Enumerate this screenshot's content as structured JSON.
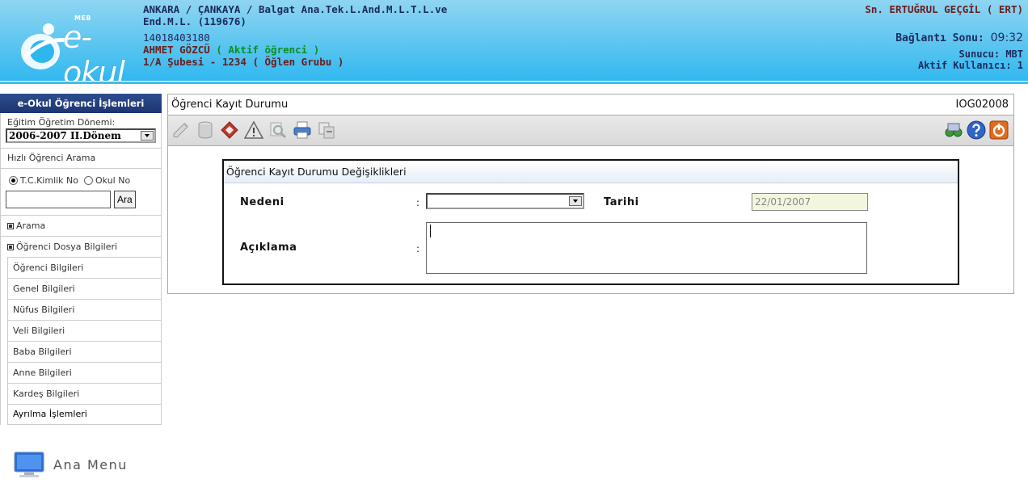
{
  "header": {
    "logo_text": "e-okul",
    "logo_meb": "MEB",
    "school_line1": "ANKARA / ÇANKAYA / Balgat Ana.Tek.L.And.M.L.T.L.ve",
    "school_line2": "End.M.L. (119676)",
    "student_id": "14018403180",
    "student_name": "AHMET GÖZCÜ",
    "student_status": "( Aktif öğrenci )",
    "student_class": "1/A Şubesi - 1234 ( Öğlen Grubu )",
    "user": "Sn. ERTUĞRUL GEÇGİL ( ERT)",
    "connection_label": "Bağlantı Sonu:",
    "connection_time": "09:32",
    "server": "Sunucu: MBT",
    "active_users": "Aktif Kullanıcı: 1"
  },
  "sidebar": {
    "title": "e-Okul Öğrenci İşlemleri",
    "period_label": "Eğitim Öğretim Dönemi:",
    "period_value": "2006-2007 II.Dönem",
    "quick_search_label": "Hızlı Öğrenci Arama",
    "radio_tc": "T.C.Kimlik No",
    "radio_school": "Okul No",
    "search_button": "Ara",
    "search_value": "",
    "items": {
      "search": "Arama",
      "student_files": "Öğrenci Dosya Bilgileri",
      "student_info": "Öğrenci Bilgileri",
      "general_info": "Genel Bilgileri",
      "census_info": "Nüfus Bilgileri",
      "guardian_info": "Veli Bilgileri",
      "father_info": "Baba Bilgileri",
      "mother_info": "Anne Bilgileri",
      "sibling_info": "Kardeş Bilgileri",
      "leaving_ops": "Ayrılma İşlemleri"
    },
    "main_menu": "Ana Menu"
  },
  "main": {
    "title": "Öğrenci Kayıt Durumu",
    "code": "IOG02008",
    "toolbar_icons": [
      "edit-icon",
      "database-icon",
      "erase-icon",
      "warning-icon",
      "search-icon",
      "print-icon",
      "transfer-icon"
    ],
    "toolbar_right_icons": [
      "binoculars-icon",
      "help-icon",
      "exit-icon"
    ]
  },
  "form": {
    "heading": "Öğrenci Kayıt Durumu Değişiklikleri",
    "reason_label": "Nedeni",
    "reason_value": "",
    "date_label": "Tarihi",
    "date_value": "22/01/2007",
    "description_label": "Açıklama",
    "description_value": "",
    "colon": ":"
  }
}
